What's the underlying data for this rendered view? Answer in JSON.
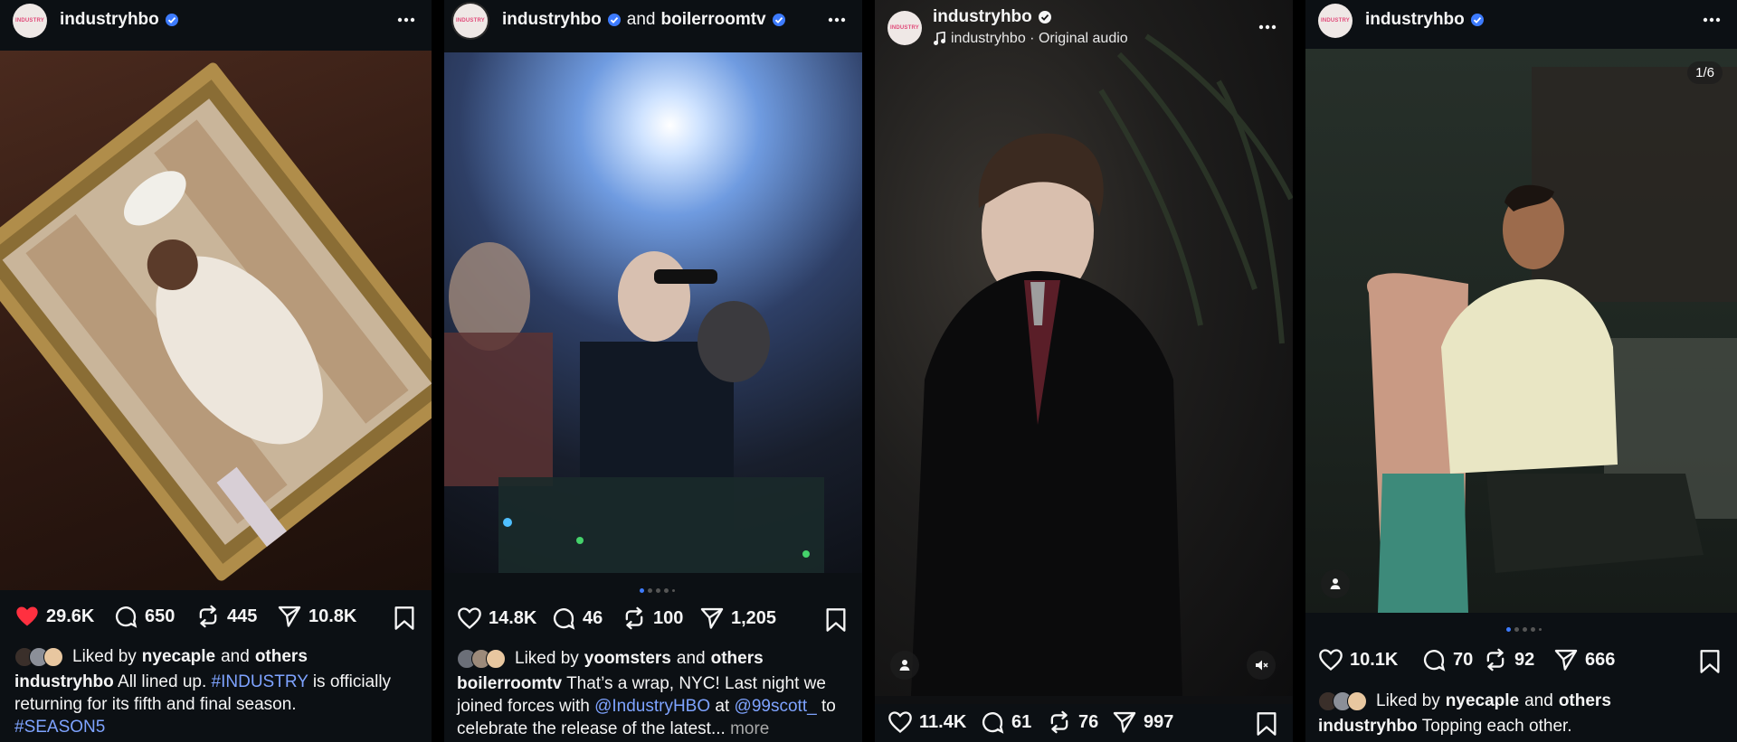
{
  "colors": {
    "background": "#0c1014",
    "text": "#f5f5f5",
    "link": "#7ea3ff",
    "verified": "#3d7bff",
    "liked_heart": "#ff3040",
    "muted": "#a8a8a8"
  },
  "posts": [
    {
      "username": "industryhbo",
      "avatar_text": "INDUSTRY",
      "liked": true,
      "stats": {
        "likes": "29.6K",
        "comments": "650",
        "reposts": "445",
        "shares": "10.8K"
      },
      "liked_by": {
        "prefix": "Liked by",
        "user": "nyecaple",
        "and": "and",
        "others": "others"
      },
      "caption": {
        "user": "industryhbo",
        "text_1": "All lined up.",
        "hashtag_1": "#INDUSTRY",
        "text_2": "is officially returning for its fifth and final season.",
        "hashtag_2": "#SEASON5"
      },
      "icons": {
        "more": "more-dots-icon",
        "heart": "heart-icon",
        "comment": "comment-icon",
        "repost": "repost-icon",
        "share": "share-icon",
        "bookmark": "bookmark-icon"
      }
    },
    {
      "username": "industryhbo",
      "and_text": "and",
      "collab_username": "boilerroomtv",
      "avatar_text": "INDUSTRY",
      "stats": {
        "likes": "14.8K",
        "comments": "46",
        "reposts": "100",
        "shares": "1,205"
      },
      "carousel": {
        "count": 5,
        "active_index": 0
      },
      "liked_by": {
        "prefix": "Liked by",
        "user": "yoomsters",
        "and": "and",
        "others": "others"
      },
      "caption": {
        "user": "boilerroomtv",
        "text_1": "That’s a wrap, NYC! Last night we joined forces with",
        "mention_1": "@IndustryHBO",
        "at": "at",
        "mention_2": "@99scott_",
        "text_2": "to celebrate the release of the latest...",
        "more": "more"
      }
    },
    {
      "username": "industryhbo",
      "avatar_text": "INDUSTRY",
      "audio": {
        "icon": "music-note-icon",
        "text": "industryhbo · Original audio"
      },
      "stats": {
        "likes": "11.4K",
        "comments": "61",
        "reposts": "76",
        "shares": "997"
      },
      "controls": {
        "tag_icon": "person-icon",
        "mute_icon": "muted-speaker-icon"
      }
    },
    {
      "username": "industryhbo",
      "avatar_text": "INDUSTRY",
      "counter": "1/6",
      "stats": {
        "likes": "10.1K",
        "comments": "70",
        "reposts": "92",
        "shares": "666"
      },
      "carousel": {
        "count": 5,
        "active_index": 0
      },
      "liked_by": {
        "prefix": "Liked by",
        "user": "nyecaple",
        "and": "and",
        "others": "others"
      },
      "caption": {
        "user": "industryhbo",
        "text_1": "Topping each other."
      },
      "controls": {
        "tag_icon": "person-icon"
      }
    }
  ]
}
